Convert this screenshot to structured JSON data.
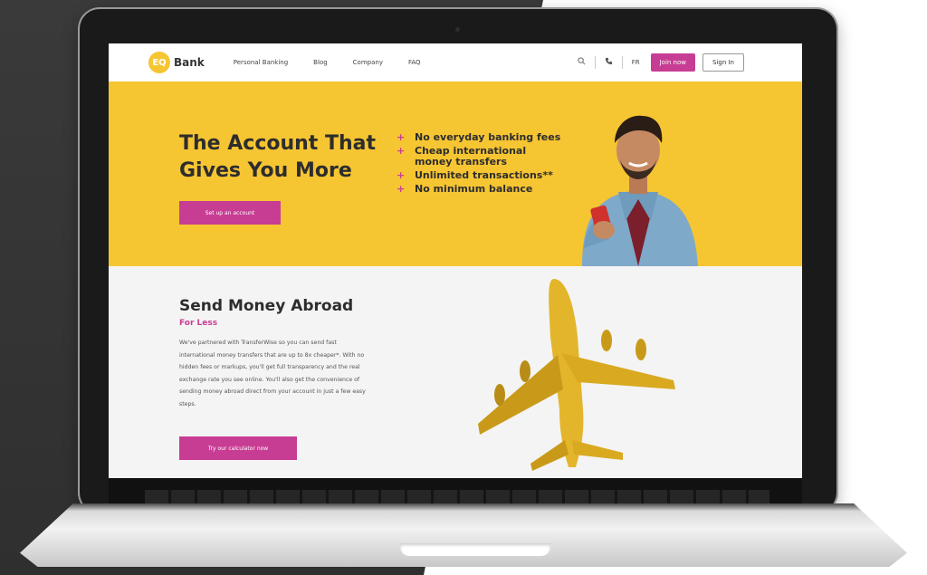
{
  "nav": {
    "logo_mark": "EQ",
    "logo_text": "Bank",
    "links": [
      "Personal Banking",
      "Blog",
      "Company",
      "FAQ"
    ],
    "lang": "FR",
    "join_label": "Join now",
    "signin_label": "Sign In",
    "icons": [
      "search-icon",
      "phone-icon"
    ]
  },
  "hero": {
    "title": "The Account That Gives You More",
    "cta": "Set up an account",
    "features": [
      "No everyday banking fees",
      "Cheap international money transfers",
      "Unlimited transactions**",
      "No minimum balance"
    ],
    "feature_bullet": "+"
  },
  "section2": {
    "title": "Send Money Abroad",
    "subtitle": "For Less",
    "body": "We've partnered with TransferWise so you can send fast international money transfers that are up to 8x cheaper*. With no hidden fees or markups, you'll get full transparency and the real exchange rate you see online. You'll also get the convenience of sending money abroad direct from your account in just a few easy steps.",
    "cta": "Try our calculator now"
  },
  "colors": {
    "brand_yellow": "#f6c532",
    "brand_pink": "#c83d94"
  }
}
